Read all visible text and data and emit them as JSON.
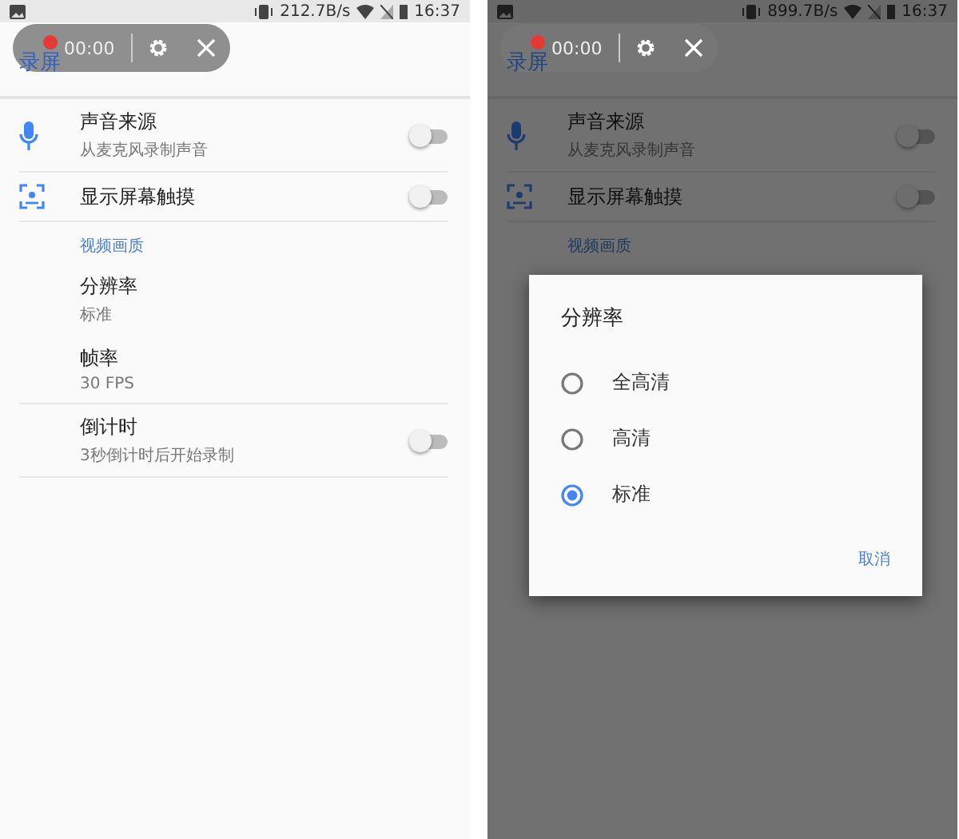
{
  "screens": [
    {
      "status_bar": {
        "speed": "212.7B/s",
        "time": "16:37"
      },
      "app_title": "录屏",
      "recorder": {
        "timer": "00:00"
      },
      "settings": [
        {
          "kind": "toggle",
          "title": "声音来源",
          "subtitle": "从麦克风录制声音",
          "on": false
        },
        {
          "kind": "toggle",
          "title": "显示屏幕触摸",
          "on": false
        },
        {
          "kind": "header",
          "title": "视频画质"
        },
        {
          "kind": "value",
          "title": "分辨率",
          "subtitle": "标准"
        },
        {
          "kind": "value",
          "title": "帧率",
          "subtitle": "30 FPS"
        },
        {
          "kind": "toggle",
          "title": "倒计时",
          "subtitle": "3秒倒计时后开始录制",
          "on": false
        }
      ]
    },
    {
      "status_bar": {
        "speed": "899.7B/s",
        "time": "16:37"
      },
      "app_title": "录屏",
      "recorder": {
        "timer": "00:00"
      },
      "settings": [
        {
          "kind": "toggle",
          "title": "声音来源",
          "subtitle": "从麦克风录制声音",
          "on": false
        },
        {
          "kind": "toggle",
          "title": "显示屏幕触摸",
          "on": false
        },
        {
          "kind": "header",
          "title": "视频画质"
        }
      ],
      "dialog": {
        "title": "分辨率",
        "options": [
          {
            "label": "全高清",
            "selected": false
          },
          {
            "label": "高清",
            "selected": false
          },
          {
            "label": "标准",
            "selected": true
          }
        ],
        "button": "取消"
      }
    }
  ]
}
